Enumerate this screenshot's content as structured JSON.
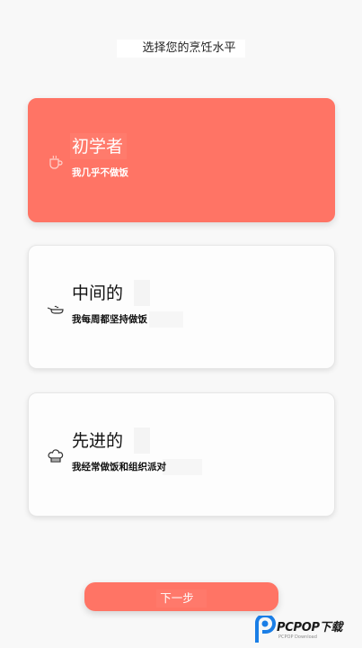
{
  "header": {
    "title": "选择您的烹饪水平"
  },
  "levels": [
    {
      "title": "初学者",
      "description": "我几乎不做饭",
      "icon": "coffee-cup-icon",
      "selected": true
    },
    {
      "title": "中间的",
      "description": "我每周都坚持做饭",
      "icon": "frying-pan-icon",
      "selected": false
    },
    {
      "title": "先进的",
      "description": "我经常做饭和组织派对",
      "icon": "chef-hat-icon",
      "selected": false
    }
  ],
  "footer": {
    "next_label": "下一步"
  },
  "watermark": {
    "brand": "PCPOP下载",
    "tagline": "PCPOP Download"
  },
  "colors": {
    "accent": "#ff7465",
    "background": "#f8f8f8",
    "card": "#fdfdfd"
  }
}
